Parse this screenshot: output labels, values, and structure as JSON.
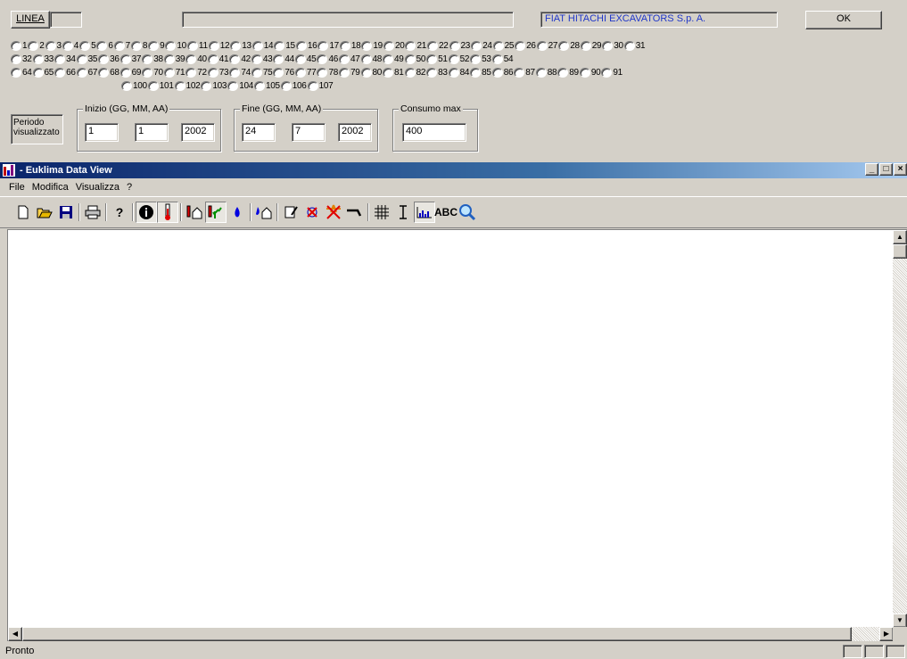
{
  "top": {
    "linea_label": "LINEA",
    "company": "FIAT HITACHI EXCAVATORS S.p. A.",
    "ok_label": "OK"
  },
  "radios": {
    "row1": [
      "1",
      "2",
      "3",
      "4",
      "5",
      "6",
      "7",
      "8",
      "9",
      "10",
      "11",
      "12",
      "13",
      "14",
      "15",
      "16",
      "17",
      "18",
      "19",
      "20",
      "21",
      "22",
      "23",
      "24",
      "25",
      "26",
      "27",
      "28",
      "29",
      "30",
      "31"
    ],
    "row2": [
      "32",
      "33",
      "34",
      "35",
      "36",
      "37",
      "38",
      "39",
      "40",
      "41",
      "42",
      "43",
      "44",
      "45",
      "46",
      "47",
      "48",
      "49",
      "50",
      "51",
      "52",
      "53",
      "54"
    ],
    "row3": [
      "64",
      "65",
      "66",
      "67",
      "68",
      "69",
      "70",
      "71",
      "72",
      "73",
      "74",
      "75",
      "76",
      "77",
      "78",
      "79",
      "80",
      "81",
      "82",
      "83",
      "84",
      "85",
      "86",
      "87",
      "88",
      "89",
      "90",
      "91"
    ],
    "row4": [
      "100",
      "101",
      "102",
      "103",
      "104",
      "105",
      "106",
      "107"
    ]
  },
  "period": {
    "label": "Periodo visualizzato",
    "inizio_title": "Inizio (GG, MM, AA)",
    "inizio_gg": "1",
    "inizio_mm": "1",
    "inizio_aa": "2002",
    "fine_title": "Fine (GG, MM, AA)",
    "fine_gg": "24",
    "fine_mm": "7",
    "fine_aa": "2002",
    "consumo_title": "Consumo max",
    "consumo_value": "400"
  },
  "window": {
    "title": " - Euklima Data View",
    "min_icon": "minimize-icon",
    "max_icon": "maximize-icon",
    "close_icon": "close-icon"
  },
  "menu": [
    "File",
    "Modifica",
    "Visualizza",
    "?"
  ],
  "toolbar_icons": [
    "new-icon",
    "open-icon",
    "save-icon",
    "print-icon",
    "help-icon",
    "info-icon",
    "thermometer-icon",
    "temp-house-icon",
    "plant-icon",
    "drop-icon",
    "humidity-house-icon",
    "tool-icon",
    "cross-icon",
    "star-cross-icon",
    "pipe-icon",
    "grid-icon",
    "height-icon",
    "bar-chart-icon",
    "text-icon",
    "zoom-icon"
  ],
  "status": {
    "text": "Pronto"
  },
  "colors": {
    "title_start": "#0a246a",
    "title_end": "#a6caf0",
    "company_text": "#1f36c9"
  }
}
